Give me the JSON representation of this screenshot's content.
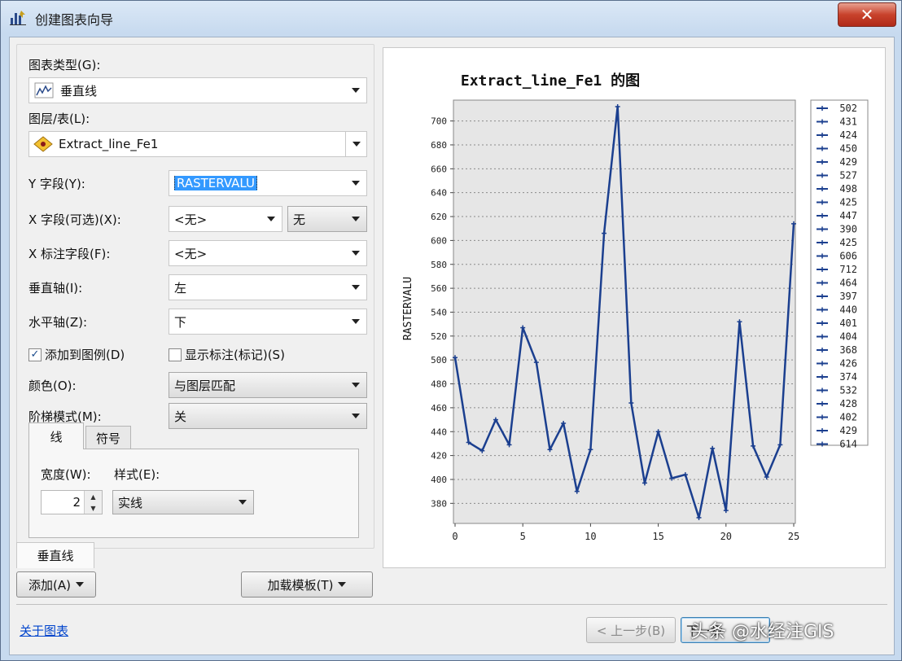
{
  "window": {
    "title": "创建图表向导",
    "close_glyph": "✕"
  },
  "form": {
    "chart_type_label": "图表类型(G):",
    "chart_type_value": "垂直线",
    "layer_label": "图层/表(L):",
    "layer_value": "Extract_line_Fe1",
    "y_field_label": "Y 字段(Y):",
    "y_field_value": "RASTERVALU",
    "x_field_label": "X 字段(可选)(X):",
    "x_field_value": "<无>",
    "x_field_sort_value": "无",
    "x_label_field_label": "X 标注字段(F):",
    "x_label_field_value": "<无>",
    "vertical_axis_label": "垂直轴(I):",
    "vertical_axis_value": "左",
    "horizontal_axis_label": "水平轴(Z):",
    "horizontal_axis_value": "下",
    "add_legend_label": "添加到图例(D)",
    "add_legend_checked": true,
    "show_labels_label": "显示标注(标记)(S)",
    "show_labels_checked": false,
    "color_label": "颜色(O):",
    "color_value": "与图层匹配",
    "multi_series_label": "阶梯模式(M):",
    "multi_series_value": "关"
  },
  "tabs": {
    "line_tab": "线",
    "symbol_tab": "符号",
    "width_label": "宽度(W):",
    "width_value": "2",
    "style_label": "样式(E):",
    "style_value": "实线"
  },
  "bottom": {
    "series_tab": "垂直线",
    "add_button": "添加(A)",
    "load_template_button": "加载模板(T)",
    "about_link": "关于图表",
    "back_button": "< 上一步(B)",
    "next_button": "下一步",
    "watermark": "头条 @水经注GIS"
  },
  "colors": {
    "line": "#1b3f8f",
    "plot_bg": "#e6e6e6"
  },
  "chart_data": {
    "type": "line",
    "title": "Extract_line_Fe1 的图",
    "ylabel": "RASTERVALU",
    "xlabel": "",
    "x": [
      0,
      1,
      2,
      3,
      4,
      5,
      6,
      7,
      8,
      9,
      10,
      11,
      12,
      13,
      14,
      15,
      16,
      17,
      18,
      19,
      20,
      21,
      22,
      23,
      24,
      25
    ],
    "values": [
      502,
      431,
      424,
      450,
      429,
      527,
      498,
      425,
      447,
      390,
      425,
      606,
      712,
      464,
      397,
      440,
      401,
      404,
      368,
      426,
      374,
      532,
      428,
      402,
      429,
      614
    ],
    "ylim": [
      370,
      712
    ],
    "yticks": [
      380,
      400,
      420,
      440,
      460,
      480,
      500,
      520,
      540,
      560,
      580,
      600,
      620,
      640,
      660,
      680,
      700
    ],
    "xticks": [
      0,
      5,
      10,
      15,
      20,
      25
    ],
    "grid": true,
    "legend_position": "right",
    "legend": [
      "502",
      "431",
      "424",
      "450",
      "429",
      "527",
      "498",
      "425",
      "447",
      "390",
      "425",
      "606",
      "712",
      "464",
      "397",
      "440",
      "401",
      "404",
      "368",
      "426",
      "374",
      "532",
      "428",
      "402",
      "429",
      "614"
    ]
  }
}
